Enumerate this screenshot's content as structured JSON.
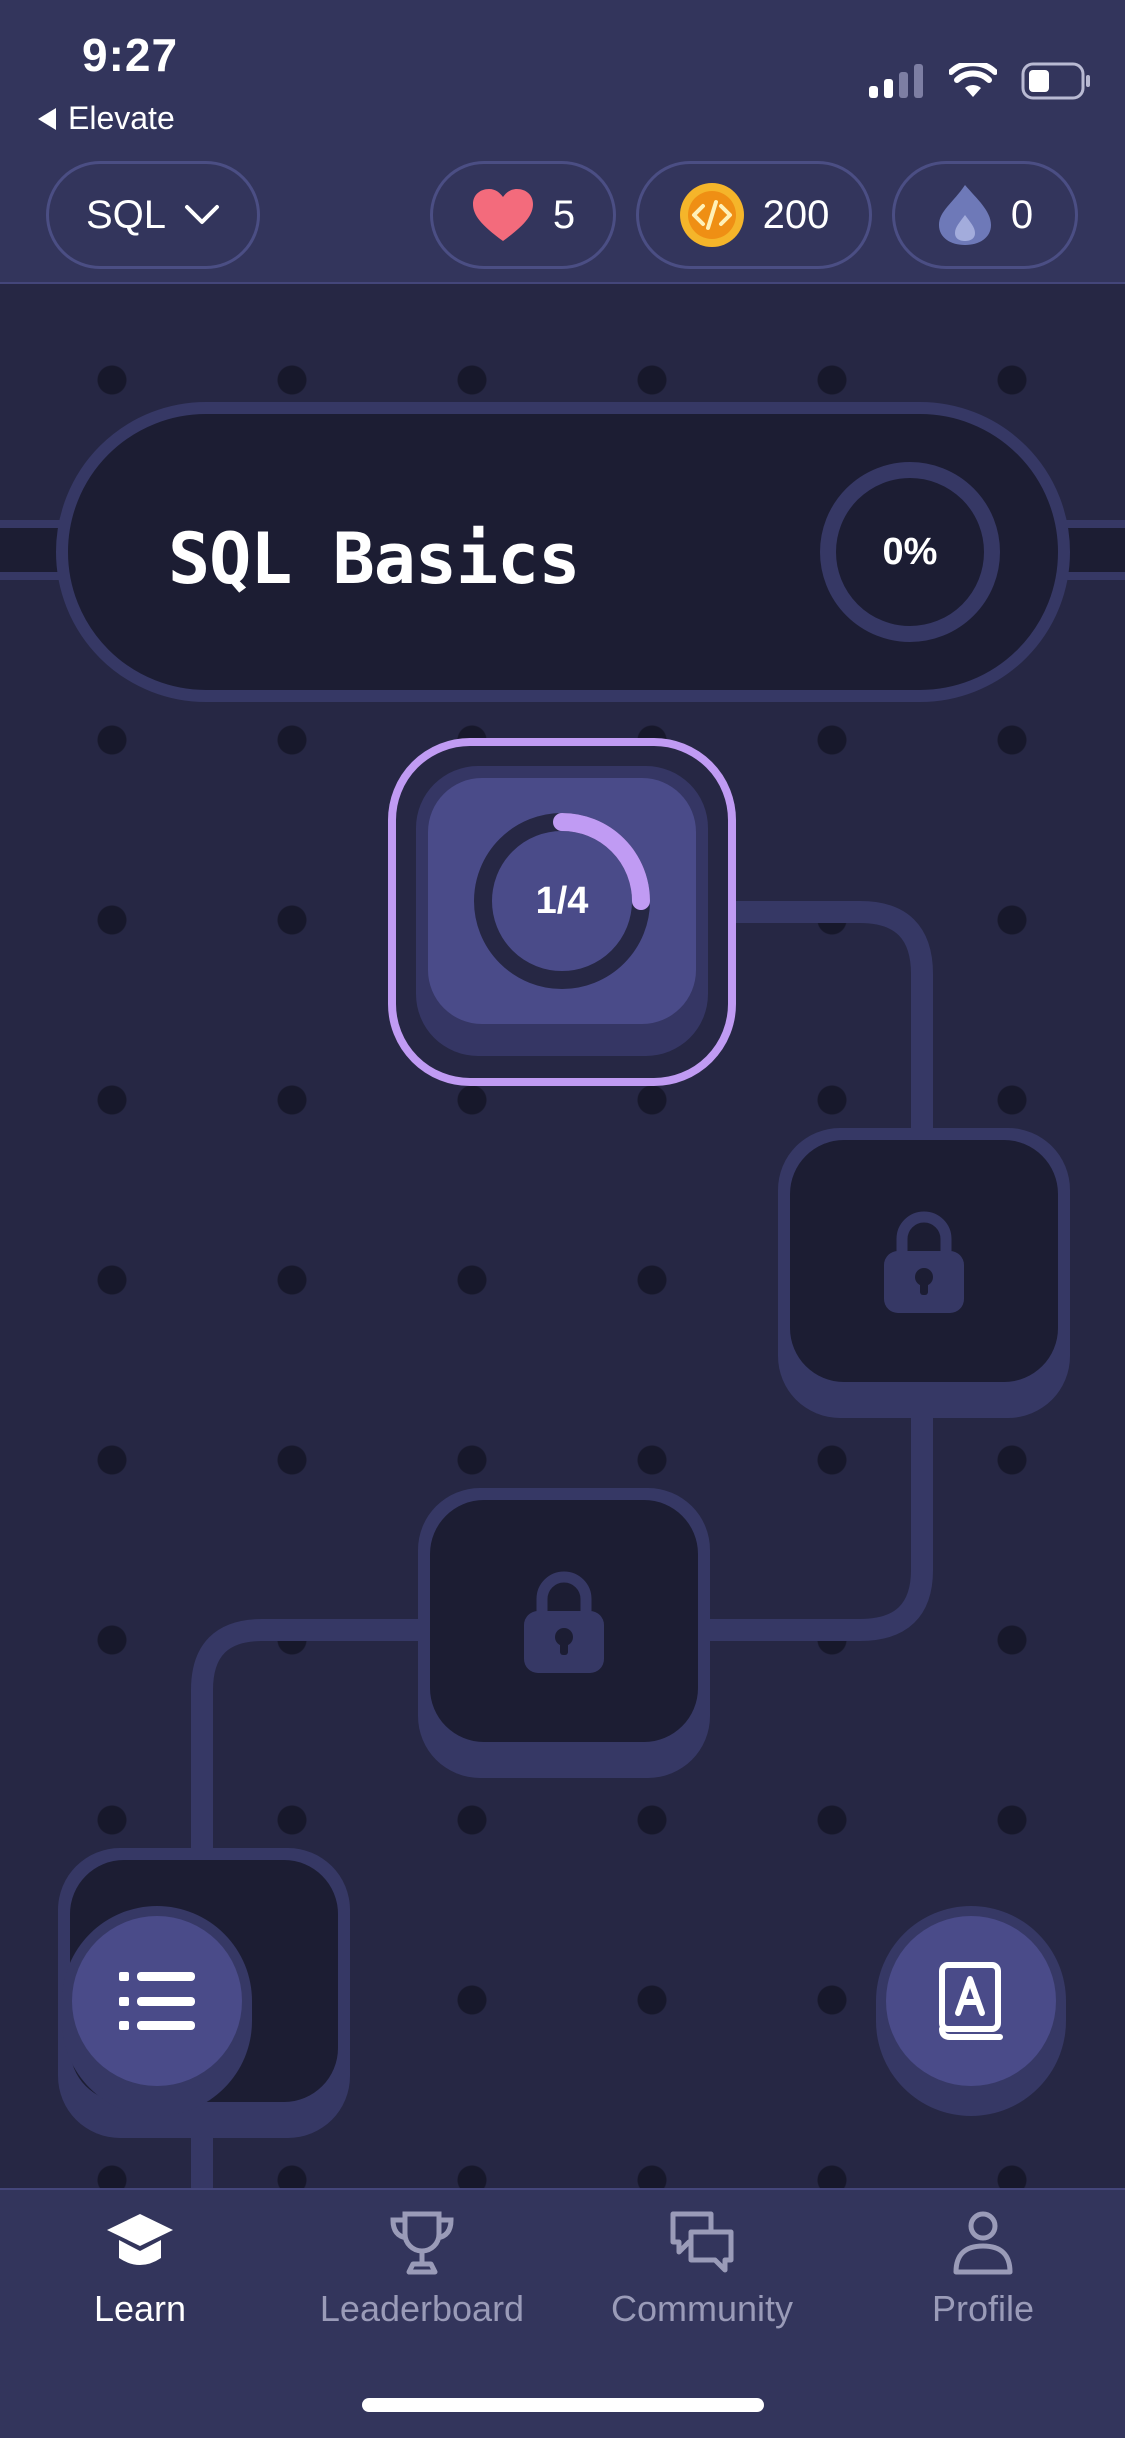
{
  "status_bar": {
    "time": "9:27",
    "back_app": "Elevate"
  },
  "header": {
    "course_selector": "SQL",
    "hearts": "5",
    "coins": "200",
    "streak": "0"
  },
  "course": {
    "title": "SQL Basics",
    "progress": "0%"
  },
  "nodes": {
    "active": {
      "progress_label": "1/4",
      "progress_fraction": 0.25,
      "state": "in-progress"
    },
    "locked": [
      {
        "state": "locked"
      },
      {
        "state": "locked"
      },
      {
        "state": "locked"
      }
    ]
  },
  "fab": {
    "left_icon": "list-icon",
    "right_icon": "dictionary-icon"
  },
  "tabs": [
    {
      "label": "Learn",
      "icon": "graduation-cap-icon",
      "active": true
    },
    {
      "label": "Leaderboard",
      "icon": "trophy-icon",
      "active": false
    },
    {
      "label": "Community",
      "icon": "chat-bubbles-icon",
      "active": false
    },
    {
      "label": "Profile",
      "icon": "person-icon",
      "active": false
    }
  ],
  "colors": {
    "background": "#262744",
    "header": "#33355c",
    "accent": "#c09bf3",
    "node_face": "#4a4b89",
    "locked_face": "#1c1d33",
    "heart": "#f36b7c",
    "coin": "#f5b52a"
  }
}
